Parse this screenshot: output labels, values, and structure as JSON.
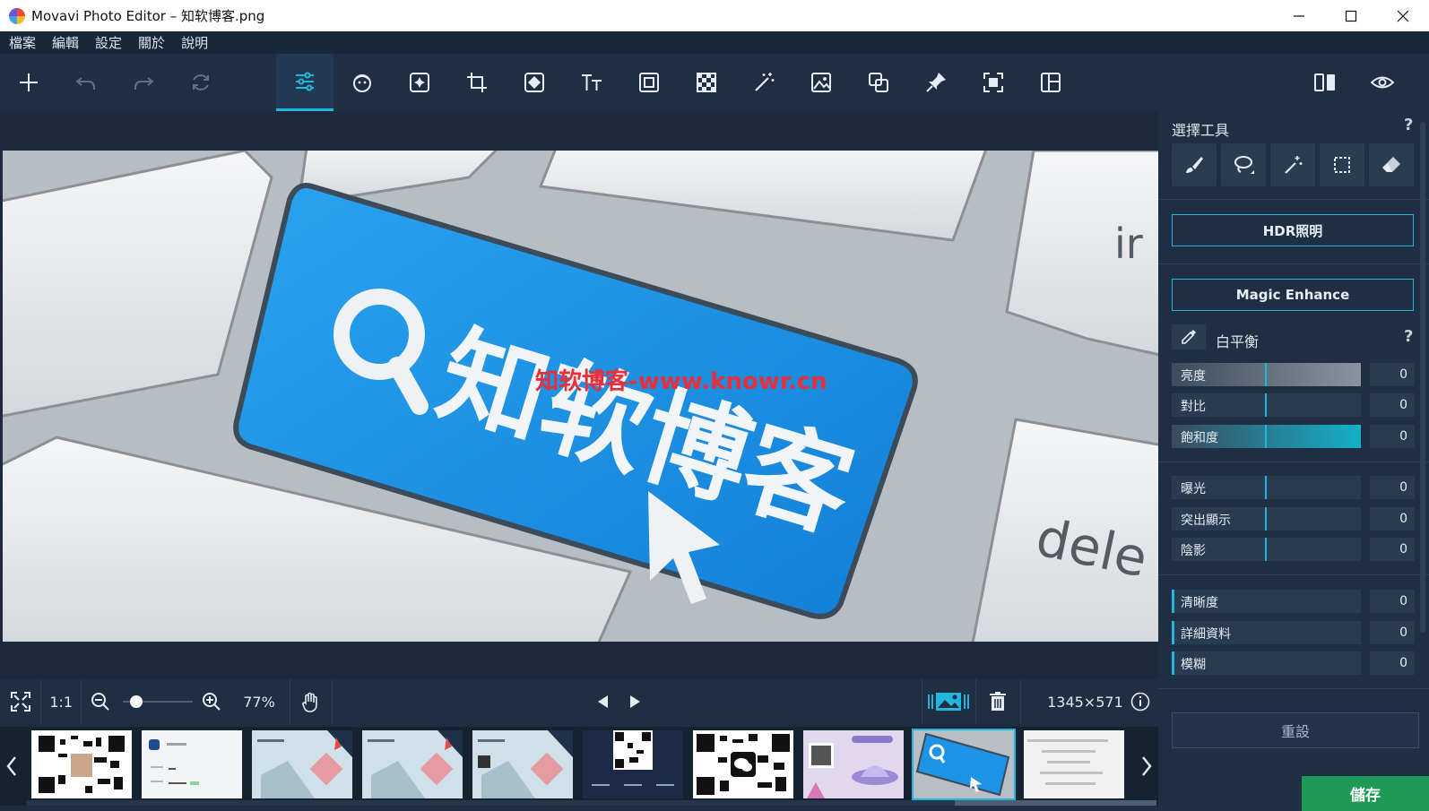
{
  "window": {
    "title": "Movavi Photo Editor – 知软博客.png"
  },
  "menu": {
    "items": [
      "檔案",
      "編輯",
      "設定",
      "關於",
      "說明"
    ]
  },
  "toolbar": {
    "tools": [
      "add-icon",
      "undo-icon",
      "redo-icon",
      "rotate-icon",
      "adjust-icon",
      "retouch-icon",
      "effects-icon",
      "crop-icon",
      "background-icon",
      "text-icon",
      "frame-icon",
      "transparency-icon",
      "magic-wand-icon",
      "insert-image-icon",
      "replace-icon",
      "pin-icon",
      "resize-icon",
      "layout-icon",
      "compare-icon",
      "preview-icon"
    ]
  },
  "photo": {
    "keycap_text": "知软博客",
    "watermark": "知软博客-www.knowr.cn",
    "key_fragment_1": "dele",
    "key_fragment_2": "ir"
  },
  "viewbar": {
    "fit_label": "1:1",
    "zoom": "77%",
    "dimensions": "1345×571",
    "zoom_level": 0.12
  },
  "panel": {
    "selection_tools_title": "選擇工具",
    "help": "?",
    "hdr_button": "HDR照明",
    "magic_button": "Magic Enhance",
    "white_balance": "白平衡",
    "sliders_group1": [
      {
        "label": "亮度",
        "value": "0"
      },
      {
        "label": "對比",
        "value": "0"
      },
      {
        "label": "飽和度",
        "value": "0"
      }
    ],
    "sliders_group2": [
      {
        "label": "曝光",
        "value": "0"
      },
      {
        "label": "突出顯示",
        "value": "0"
      },
      {
        "label": "陰影",
        "value": "0"
      }
    ],
    "sliders_group3": [
      {
        "label": "清晰度",
        "value": "0"
      },
      {
        "label": "詳細資料",
        "value": "0"
      },
      {
        "label": "模糊",
        "value": "0"
      }
    ],
    "reset_button": "重設",
    "save_button": "儲存"
  },
  "colors": {
    "accent": "#1fb7dd",
    "save_green": "#1e9a57",
    "keycap_blue": "#1c8fe4"
  }
}
